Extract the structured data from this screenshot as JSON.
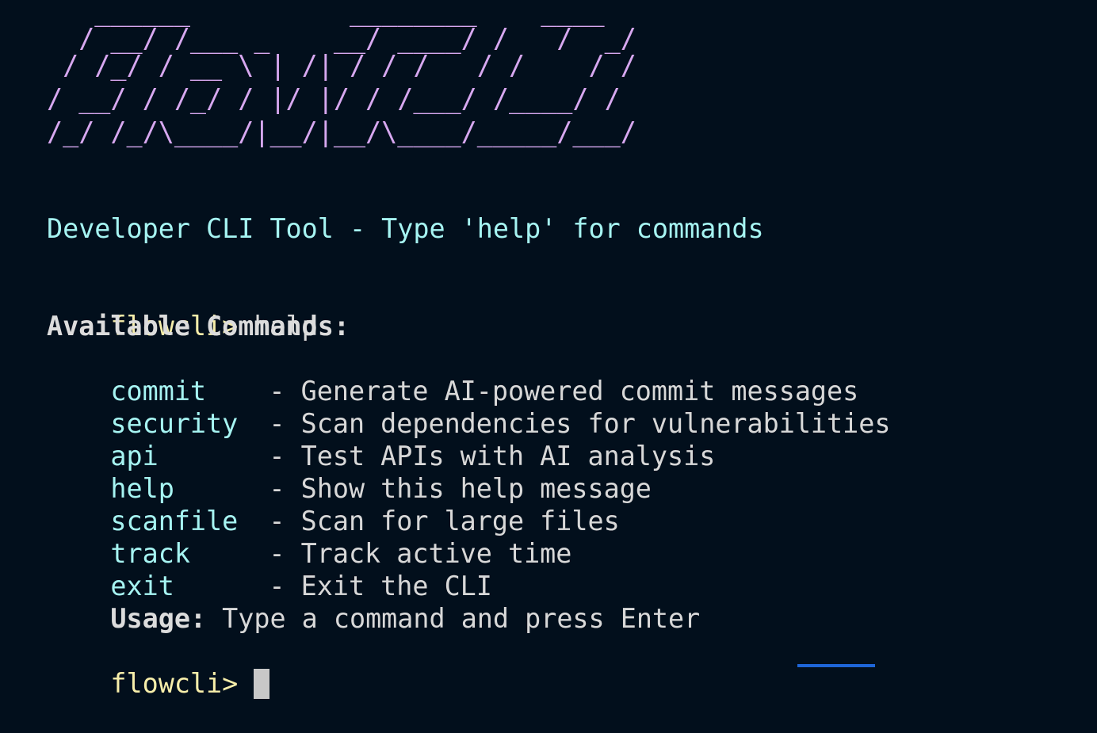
{
  "banner": {
    "lines": [
      "   ______          ________    ____",
      "  / __/ /___ _    __/ ____/ /   /  _/",
      " / /_/ / __ \\ | /| / / /   / /    / /  ",
      "/ __/ / /_/ / |/ |/ / /___/ /____/ /  ",
      "/_/ /_/\\____/|__/|__/\\____/_____/___/  "
    ]
  },
  "tagline": "Developer CLI Tool - Type 'help' for commands",
  "prompt": "flowcli>",
  "history": {
    "entered_command": "help"
  },
  "help_output": {
    "heading": "Available Commands:",
    "separator": "-",
    "commands": [
      {
        "name": "commit",
        "description": "Generate AI-powered commit messages"
      },
      {
        "name": "security",
        "description": "Scan dependencies for vulnerabilities"
      },
      {
        "name": "api",
        "description": "Test APIs with AI analysis"
      },
      {
        "name": "help",
        "description": "Show this help message"
      },
      {
        "name": "scanfile",
        "description": "Scan for large files"
      },
      {
        "name": "track",
        "description": "Track active time"
      },
      {
        "name": "exit",
        "description": "Exit the CLI"
      }
    ],
    "usage_label": "Usage:",
    "usage_text": "Type a command and press Enter"
  },
  "current_input": "",
  "colors": {
    "background": "#020f1c",
    "banner": "#d7a8f0",
    "tagline": "#a6f4f2",
    "prompt": "#f7eeaa",
    "command_name": "#a6f4f2",
    "text": "#d8d8d8"
  }
}
